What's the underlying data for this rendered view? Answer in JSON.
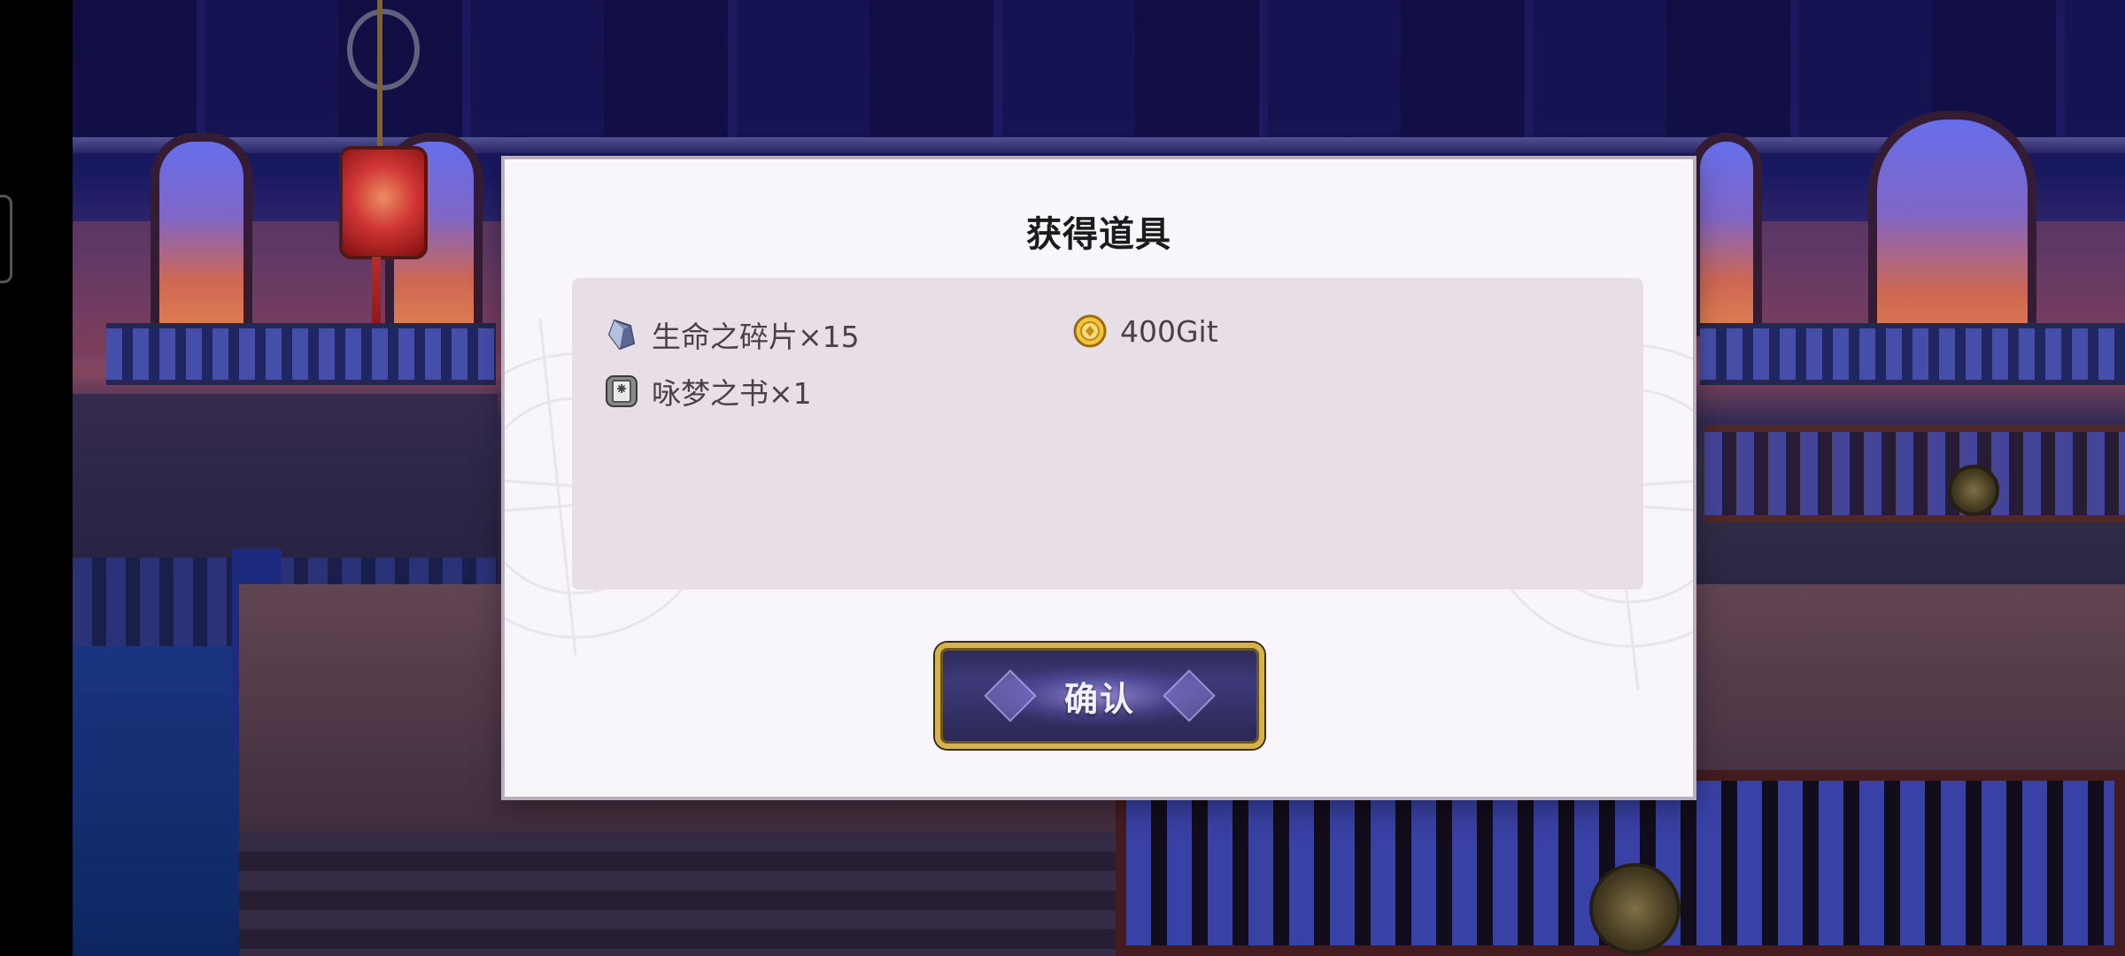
{
  "dialog": {
    "title": "获得道具",
    "rewards": [
      {
        "icon": "crystal-shard-icon",
        "label": "生命之碎片×15"
      },
      {
        "icon": "gold-coin-icon",
        "label": "400Git"
      },
      {
        "icon": "book-icon",
        "label": "咏梦之书×1"
      }
    ],
    "confirm_label": "确认"
  },
  "colors": {
    "dialog_bg": "#f8f6fa",
    "panel_bg": "#e7dfe5",
    "button_gold": "#d6b34a",
    "button_purple": "#3d3a7a"
  }
}
